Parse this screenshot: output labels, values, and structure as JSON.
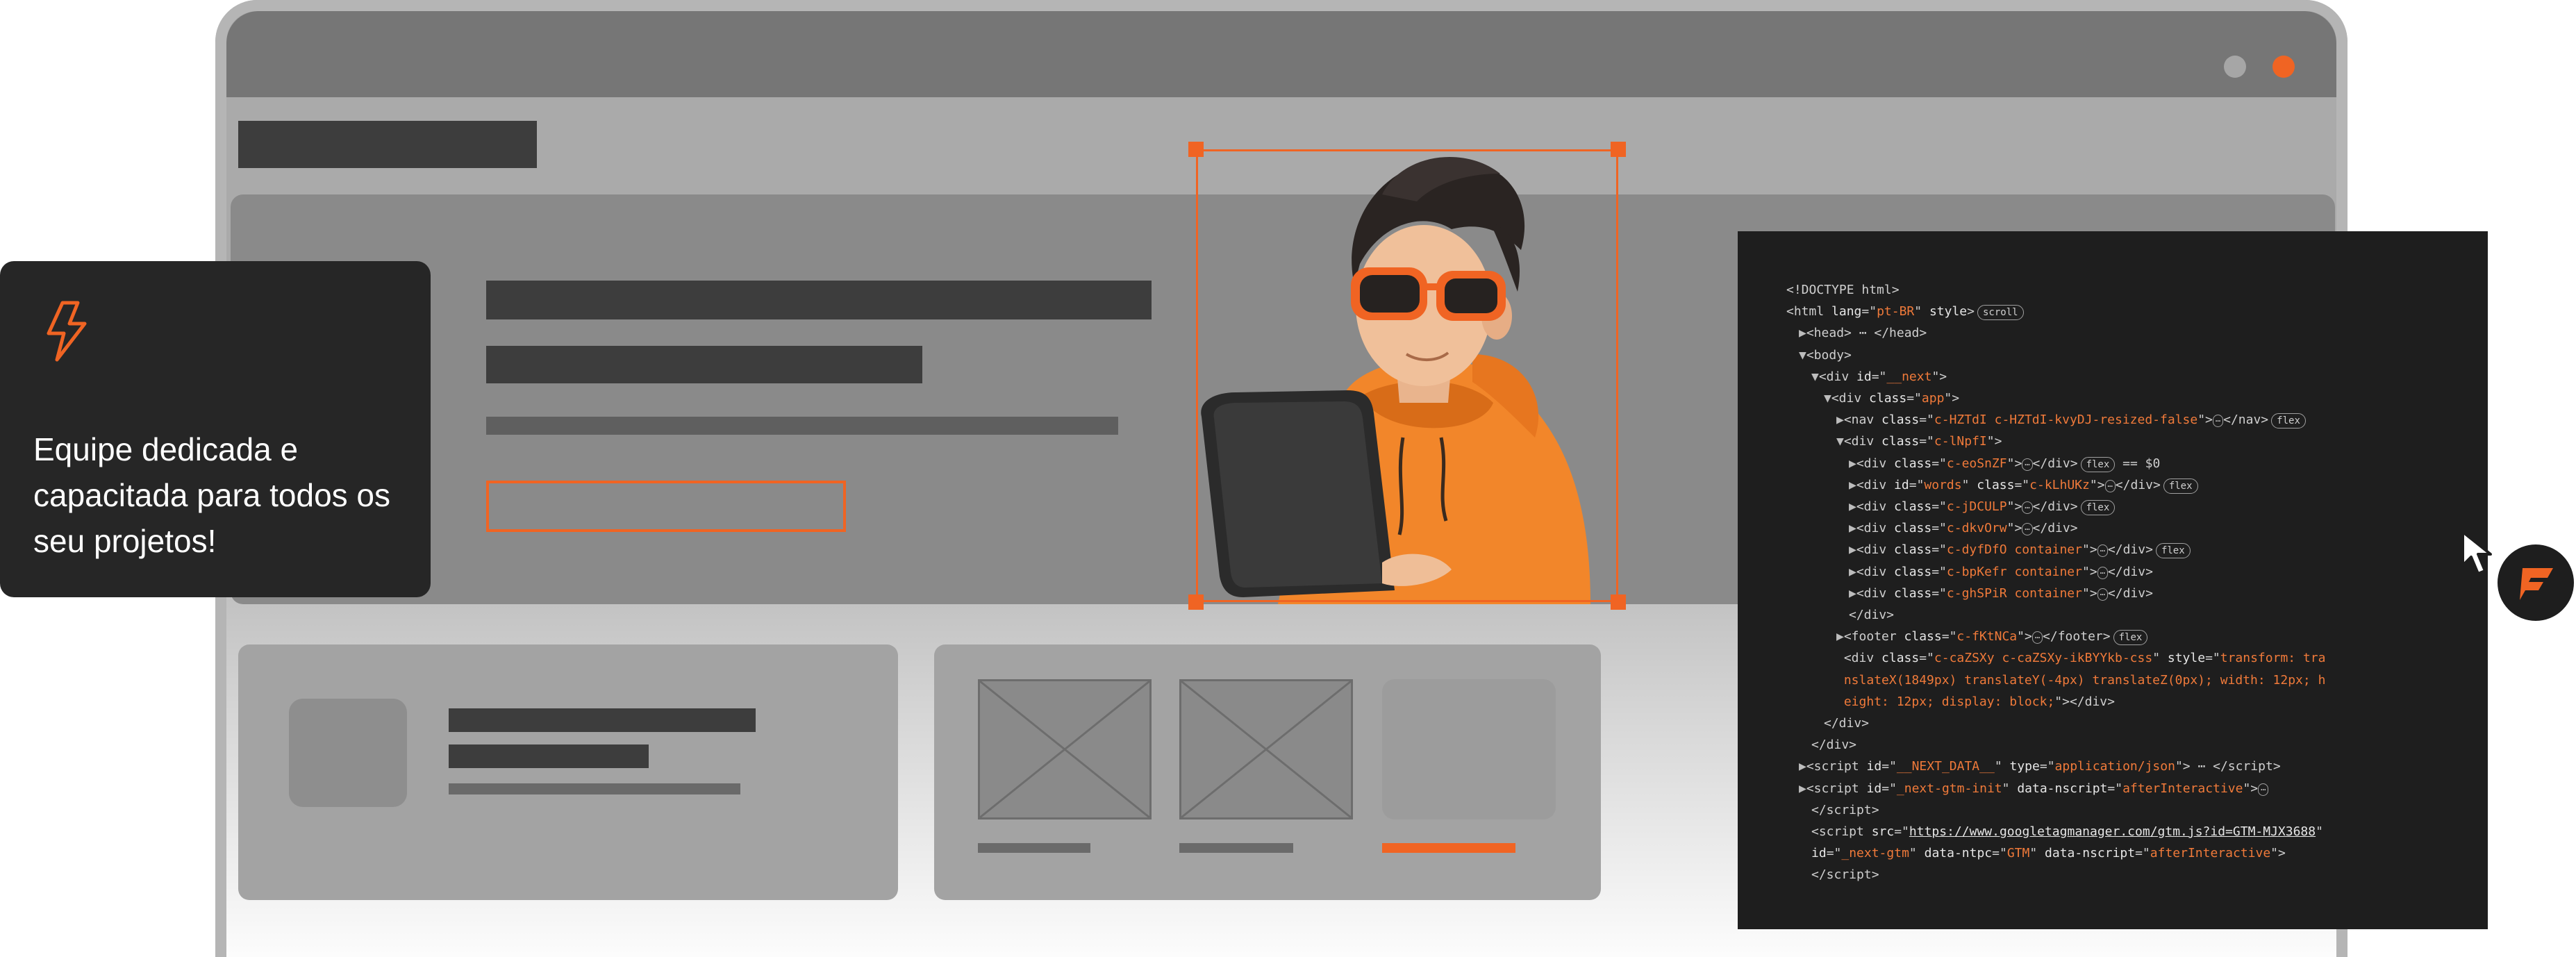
{
  "feature": {
    "icon": "lightning-bolt-icon",
    "text": "Equipe dedicada e capacitada para todos os seu projetos!",
    "accent": "#f06423"
  },
  "browser": {
    "controls": [
      "window-dot-grey",
      "window-dot-orange"
    ]
  },
  "devtools": {
    "lines": [
      {
        "indent": 0,
        "html": "&lt;!DOCTYPE html&gt;"
      },
      {
        "indent": 0,
        "html": "&lt;html <span class='attr'>lang</span>=\"<span class='val'>pt-BR</span>\" <span class='attr'>style</span>&gt;<span class='pill'>scroll</span>"
      },
      {
        "indent": 1,
        "html": "<span class='tri'>▶</span>&lt;head&gt; ⋯ &lt;/head&gt;"
      },
      {
        "indent": 1,
        "html": "<span class='tri'>▼</span>&lt;body&gt;"
      },
      {
        "indent": 2,
        "html": "<span class='tri'>▼</span>&lt;div <span class='attr'>id</span>=\"<span class='val'>__next</span>\"&gt;"
      },
      {
        "indent": 3,
        "html": "<span class='tri'>▼</span>&lt;div <span class='attr'>class</span>=\"<span class='val'>app</span>\"&gt;"
      },
      {
        "indent": 4,
        "html": "<span class='tri'>▶</span>&lt;nav <span class='attr'>class</span>=\"<span class='val'>c-HZTdI c-HZTdI-kvyDJ-resized-false</span>\"&gt;<span class='ell'>⋯</span>&lt;/nav&gt;<span class='pill'>flex</span>"
      },
      {
        "indent": 4,
        "html": "<span class='tri'>▼</span>&lt;div <span class='attr'>class</span>=\"<span class='val'>c-lNpfI</span>\"&gt;"
      },
      {
        "indent": 5,
        "html": "<span class='tri'>▶</span>&lt;div <span class='attr'>class</span>=\"<span class='val'>c-eoSnZF</span>\"&gt;<span class='ell'>⋯</span>&lt;/div&gt;<span class='pill'>flex</span> == $0"
      },
      {
        "indent": 5,
        "html": "<span class='tri'>▶</span>&lt;div <span class='attr'>id</span>=\"<span class='val'>words</span>\" <span class='attr'>class</span>=\"<span class='val'>c-kLhUKz</span>\"&gt;<span class='ell'>⋯</span>&lt;/div&gt;<span class='pill'>flex</span>"
      },
      {
        "indent": 5,
        "html": "<span class='tri'>▶</span>&lt;div <span class='attr'>class</span>=\"<span class='val'>c-jDCULP</span>\"&gt;<span class='ell'>⋯</span>&lt;/div&gt;<span class='pill'>flex</span>"
      },
      {
        "indent": 5,
        "html": "<span class='tri'>▶</span>&lt;div <span class='attr'>class</span>=\"<span class='val'>c-dkvOrw</span>\"&gt;<span class='ell'>⋯</span>&lt;/div&gt;"
      },
      {
        "indent": 5,
        "html": "<span class='tri'>▶</span>&lt;div <span class='attr'>class</span>=\"<span class='val'>c-dyfDfO container</span>\"&gt;<span class='ell'>⋯</span>&lt;/div&gt;<span class='pill'>flex</span>"
      },
      {
        "indent": 5,
        "html": "<span class='tri'>▶</span>&lt;div <span class='attr'>class</span>=\"<span class='val'>c-bpKefr container</span>\"&gt;<span class='ell'>⋯</span>&lt;/div&gt;"
      },
      {
        "indent": 5,
        "html": "<span class='tri'>▶</span>&lt;div <span class='attr'>class</span>=\"<span class='val'>c-ghSPiR container</span>\"&gt;<span class='ell'>⋯</span>&lt;/div&gt;"
      },
      {
        "indent": 5,
        "html": "&lt;/div&gt;"
      },
      {
        "indent": 4,
        "html": "<span class='tri'>▶</span>&lt;footer <span class='attr'>class</span>=\"<span class='val'>c-fKtNCa</span>\"&gt;<span class='ell'>⋯</span>&lt;/footer&gt;<span class='pill'>flex</span>"
      },
      {
        "indent": 4,
        "html": " &lt;div <span class='attr'>class</span>=\"<span class='val'>c-caZSXy c-caZSXy-ikBYYkb-css</span>\" <span class='attr'>style</span>=\"<span class='val'>transform: tra</span>"
      },
      {
        "indent": 4,
        "html": " <span class='val'>nslateX(1849px) translateY(-4px) translateZ(0px); width: 12px; h</span>"
      },
      {
        "indent": 4,
        "html": " <span class='val'>eight: 12px; display: block;</span>\"&gt;&lt;/div&gt;"
      },
      {
        "indent": 3,
        "html": "&lt;/div&gt;"
      },
      {
        "indent": 2,
        "html": "&lt;/div&gt;"
      },
      {
        "indent": 1,
        "html": "<span class='tri'>▶</span>&lt;script <span class='attr'>id</span>=\"<span class='val'>__NEXT_DATA__</span>\" <span class='attr'>type</span>=\"<span class='val'>application/json</span>\"&gt; ⋯ &lt;/script&gt;"
      },
      {
        "indent": 1,
        "html": "<span class='tri'>▶</span>&lt;script <span class='attr'>id</span>=\"<span class='val'>_next-gtm-init</span>\" <span class='attr'>data-nscript</span>=\"<span class='val'>afterInteractive</span>\"&gt;<span class='ell'>⋯</span>"
      },
      {
        "indent": 2,
        "html": "&lt;/script&gt;"
      },
      {
        "indent": 2,
        "html": "&lt;script <span class='attr'>src</span>=\"<span class='link'>https://www.googletagmanager.com/gtm.js?id=GTM-MJX3688</span>\""
      },
      {
        "indent": 2,
        "html": "<span class='attr'>id</span>=\"<span class='val'>_next-gtm</span>\" <span class='attr'>data-ntpc</span>=\"<span class='val'>GTM</span>\" <span class='attr'>data-nscript</span>=\"<span class='val'>afterInteractive</span>\"&gt;"
      },
      {
        "indent": 2,
        "html": "&lt;/script&gt;"
      }
    ]
  },
  "logo": {
    "icon": "brand-f-logo-icon"
  },
  "cursor": {
    "icon": "arrow-cursor-icon"
  }
}
